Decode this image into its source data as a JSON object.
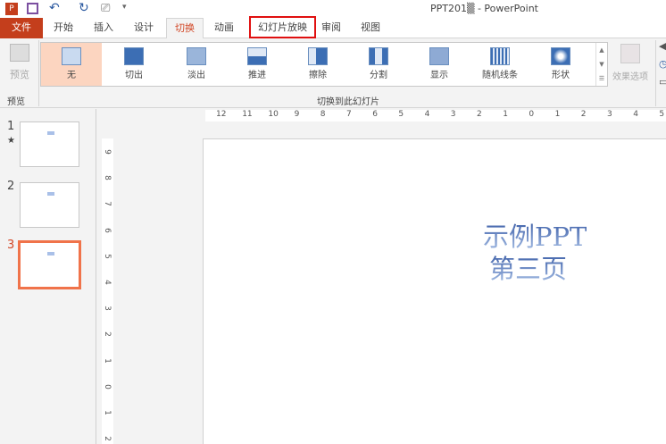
{
  "window": {
    "title": "PPT201▒ - PowerPoint"
  },
  "quick_access": {
    "icons": [
      "powerpoint-logo-icon",
      "save-icon",
      "undo-icon",
      "redo-icon",
      "present-from-start-icon",
      "customize-icon"
    ]
  },
  "tabs": [
    {
      "label": "文件"
    },
    {
      "label": "开始"
    },
    {
      "label": "插入"
    },
    {
      "label": "设计"
    },
    {
      "label": "切换",
      "active": true
    },
    {
      "label": "动画"
    },
    {
      "label": "幻灯片放映",
      "highlighted": true
    },
    {
      "label": "审阅"
    },
    {
      "label": "视图"
    }
  ],
  "ribbon": {
    "preview_button": "预览",
    "preview_group": "预览",
    "transitions": [
      {
        "label": "无",
        "selected": true
      },
      {
        "label": "切出"
      },
      {
        "label": "淡出"
      },
      {
        "label": "推进"
      },
      {
        "label": "擦除"
      },
      {
        "label": "分割"
      },
      {
        "label": "显示"
      },
      {
        "label": "随机线条"
      },
      {
        "label": "形状"
      }
    ],
    "group_label": "切换到此幻灯片",
    "effect_options": "效果选项"
  },
  "slides": [
    {
      "number": "1",
      "star": "★"
    },
    {
      "number": "2"
    },
    {
      "number": "3",
      "selected": true
    }
  ],
  "hruler": [
    "12",
    "11",
    "10",
    "9",
    "8",
    "7",
    "6",
    "5",
    "4",
    "3",
    "2",
    "1",
    "0",
    "1",
    "2",
    "3",
    "4",
    "5"
  ],
  "vruler": [
    "9",
    "8",
    "7",
    "6",
    "5",
    "4",
    "3",
    "2",
    "1",
    "0",
    "1",
    "2"
  ],
  "slide": {
    "line1": "示例PPT",
    "line2": "第三页"
  },
  "colors": {
    "accent": "#c43e1c",
    "selected_slide": "#f0734a",
    "highlight_box": "#e01010"
  }
}
